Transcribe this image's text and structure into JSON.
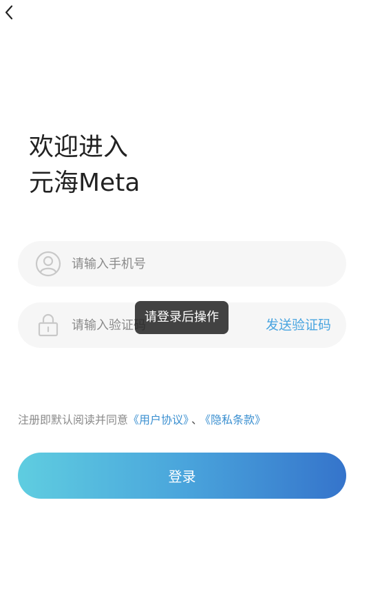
{
  "header": {
    "back_icon": "chevron-left-icon"
  },
  "welcome": {
    "line1": "欢迎进入",
    "line2": "元海Meta"
  },
  "phone_field": {
    "icon": "user-icon",
    "placeholder": "请输入手机号",
    "value": ""
  },
  "code_field": {
    "icon": "lock-icon",
    "placeholder": "请输入验证码",
    "value": "",
    "send_code_label": "发送验证码"
  },
  "toast": {
    "text": "请登录后操作"
  },
  "agreement": {
    "prefix": "注册即默认阅读并同意",
    "user_agreement": "《用户协议》",
    "separator": "、",
    "privacy_policy": "《隐私条款》"
  },
  "login_button": {
    "label": "登录"
  },
  "colors": {
    "accent": "#4aa5e0",
    "link": "#3a8fd0",
    "gradient_start": "#5fcde0",
    "gradient_end": "#3574cb"
  }
}
